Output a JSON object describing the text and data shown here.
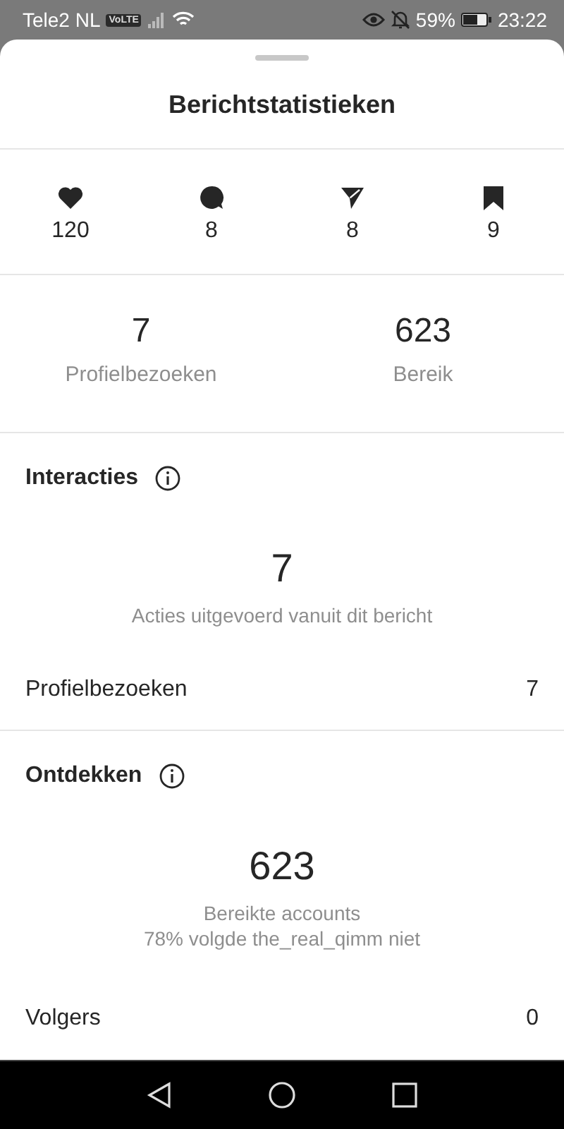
{
  "status_bar": {
    "carrier": "Tele2 NL",
    "network_badge": "VoLTE",
    "battery_percent": "59%",
    "time": "23:22"
  },
  "sheet": {
    "title": "Berichtstatistieken",
    "engagement": [
      {
        "kind": "like",
        "count": "120"
      },
      {
        "kind": "comment",
        "count": "8"
      },
      {
        "kind": "share",
        "count": "8"
      },
      {
        "kind": "save",
        "count": "9"
      }
    ],
    "summary": [
      {
        "value": "7",
        "label": "Profielbezoeken"
      },
      {
        "value": "623",
        "label": "Bereik"
      }
    ],
    "sections": [
      {
        "heading": "Interacties",
        "value": "7",
        "caption": [
          "Acties uitgevoerd vanuit dit bericht"
        ],
        "rows": [
          {
            "label": "Profielbezoeken",
            "value": "7"
          }
        ]
      },
      {
        "heading": "Ontdekken",
        "value": "623",
        "caption": [
          "Bereikte accounts",
          "78% volgde the_real_qimm niet"
        ],
        "rows": [
          {
            "label": "Volgers",
            "value": "0"
          }
        ]
      }
    ]
  }
}
